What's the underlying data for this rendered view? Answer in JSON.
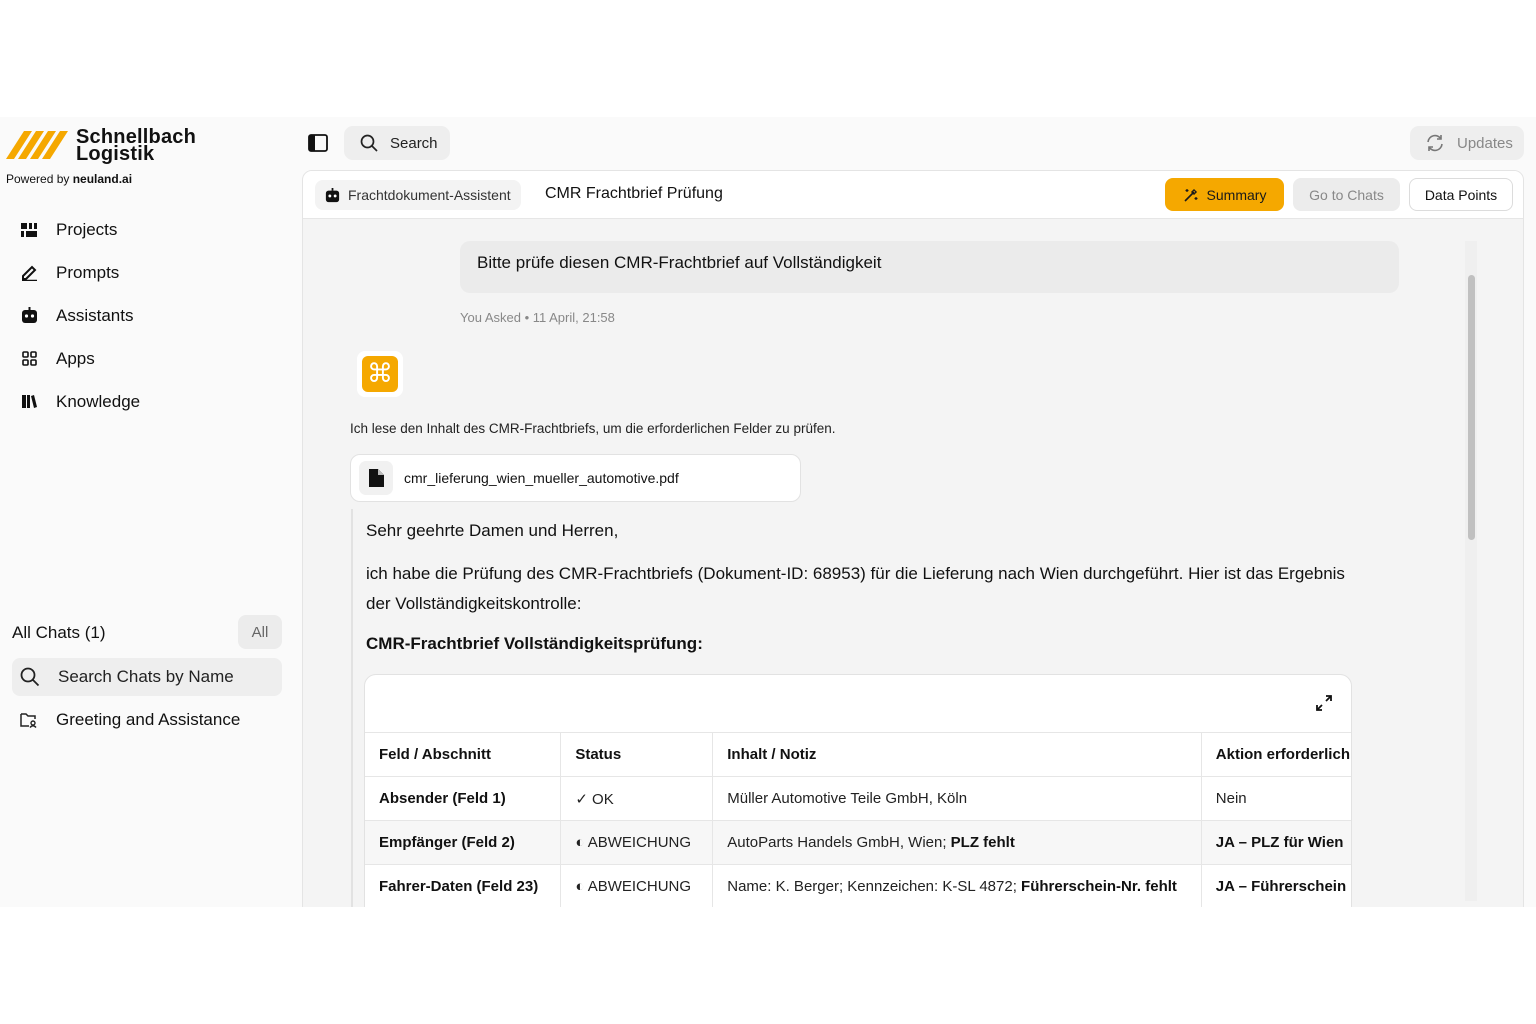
{
  "brand": {
    "name_line1": "Schnellbach",
    "name_line2": "Logistik",
    "powered_prefix": "Powered by",
    "powered_name": "neuland.ai",
    "accent": "#f5a800"
  },
  "sidebar": {
    "nav": [
      {
        "label": "Projects",
        "icon": "projects-icon"
      },
      {
        "label": "Prompts",
        "icon": "pen-icon"
      },
      {
        "label": "Assistants",
        "icon": "robot-icon"
      },
      {
        "label": "Apps",
        "icon": "apps-grid-icon"
      },
      {
        "label": "Knowledge",
        "icon": "books-icon"
      }
    ],
    "all_chats_title": "All Chats (1)",
    "all_chats_filter": "All",
    "chat_search_placeholder": "Search Chats by Name",
    "chats": [
      {
        "label": "Greeting and Assistance"
      }
    ]
  },
  "topbar": {
    "search_label": "Search",
    "updates_label": "Updates"
  },
  "panel": {
    "assistant_name": "Frachtdokument-Assistent",
    "title": "CMR Frachtbrief Prüfung",
    "summary_label": "Summary",
    "go_to_chats_label": "Go to Chats",
    "data_points_label": "Data Points"
  },
  "conversation": {
    "user_message": "Bitte prüfe diesen CMR-Frachtbrief auf Vollständigkeit",
    "user_meta": "You Asked • 11 April, 21:58",
    "bot_status": "Ich lese den Inhalt des CMR-Frachtbriefs, um die erforderlichen Felder zu prüfen.",
    "file_name": "cmr_lieferung_wien_mueller_automotive.pdf",
    "reply_greeting": "Sehr geehrte Damen und Herren,",
    "reply_body": "ich habe die Prüfung des CMR-Frachtbriefs (Dokument-ID: 68953) für die Lieferung nach Wien durchgeführt. Hier ist das Ergebnis der Vollständigkeitskontrolle:",
    "reply_heading": "CMR-Frachtbrief Vollständigkeitsprüfung:"
  },
  "table": {
    "headers": [
      "Feld / Abschnitt",
      "Status",
      "Inhalt / Notiz",
      "Aktion erforderlich"
    ],
    "rows": [
      {
        "field": "Absender (Feld 1)",
        "status": "✓ OK",
        "content": "Müller Automotive Teile GmbH, Köln",
        "content_bold": "",
        "action": "Nein"
      },
      {
        "field": "Empfänger (Feld 2)",
        "status": "◐ ABWEICHUNG",
        "content": "AutoParts Handels GmbH, Wien; ",
        "content_bold": "PLZ fehlt",
        "action": "JA – PLZ für Wien"
      },
      {
        "field": "Fahrer-Daten (Feld 23)",
        "status": "◐ ABWEICHUNG",
        "content": "Name: K. Berger; Kennzeichen: K-SL 4872; ",
        "content_bold": "Führerschein-Nr. fehlt",
        "action": "JA – Führerschein"
      }
    ]
  }
}
